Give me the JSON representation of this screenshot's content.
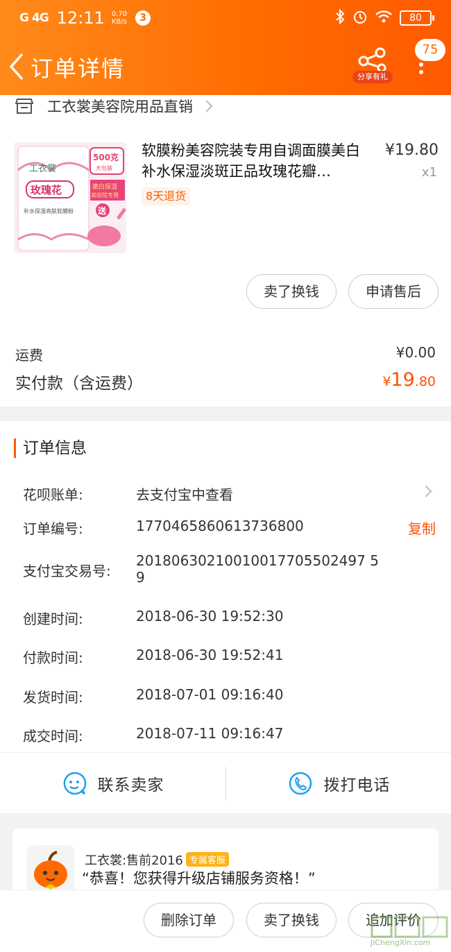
{
  "status_bar": {
    "signal": "G 4G",
    "time": "12:11",
    "speed_value": "0.70",
    "speed_unit": "KB/s",
    "notification_count": "3",
    "battery": "80"
  },
  "nav": {
    "title": "订单详情",
    "share_label": "分享有礼",
    "message_badge": "75"
  },
  "shop": {
    "name": "工衣裳美容院用品直销"
  },
  "product": {
    "title": "软膜粉美容院装专用自调面膜美白补水保湿淡斑正品玫瑰花瓣…",
    "price": "¥19.80",
    "quantity": "x1",
    "return_tag": "8天退货",
    "image_texts": {
      "brand": "工衣裳",
      "badge": "500克",
      "badge_sub": "大包装",
      "flower": "玫瑰花",
      "side1": "嫩白保湿",
      "side2": "美容院专用",
      "gift": "送",
      "desc": "补水保湿亮肤软膜粉"
    }
  },
  "item_actions": {
    "sell": "卖了换钱",
    "after_sale": "申请售后"
  },
  "summary": {
    "shipping_label": "运费",
    "shipping_value": "¥0.00",
    "paid_label": "实付款（含运费）",
    "paid_currency": "¥",
    "paid_integer": "19",
    "paid_decimal": ".80"
  },
  "order_info": {
    "title": "订单信息",
    "huabei_label": "花呗账单:",
    "huabei_value": "去支付宝中查看",
    "order_no_label": "订单编号:",
    "order_no": "1770465860613736800",
    "copy_label": "复制",
    "alipay_label": "支付宝交易号:",
    "alipay_line1": "20180630210010017705502497 5",
    "alipay_line2": "9",
    "created_label": "创建时间:",
    "created": "2018-06-30 19:52:30",
    "paid_label": "付款时间:",
    "paid": "2018-06-30 19:52:41",
    "shipped_label": "发货时间:",
    "shipped": "2018-07-01 09:16:40",
    "done_label": "成交时间:",
    "done": "2018-07-11 09:16:47"
  },
  "contact": {
    "seller": "联系卖家",
    "phone": "拨打电话"
  },
  "service": {
    "name": "工衣裳:售前2016",
    "tag": "专属客服",
    "message": "“恭喜！您获得升级店铺服务资格！”"
  },
  "bottom_actions": {
    "delete": "删除订单",
    "sell": "卖了换钱",
    "review": "追加评价"
  },
  "watermark": {
    "text": "JiChengXin.com"
  },
  "colors": {
    "header_start": "#ff8a1a",
    "header_end": "#ff5a00",
    "accent": "#ff5000"
  }
}
